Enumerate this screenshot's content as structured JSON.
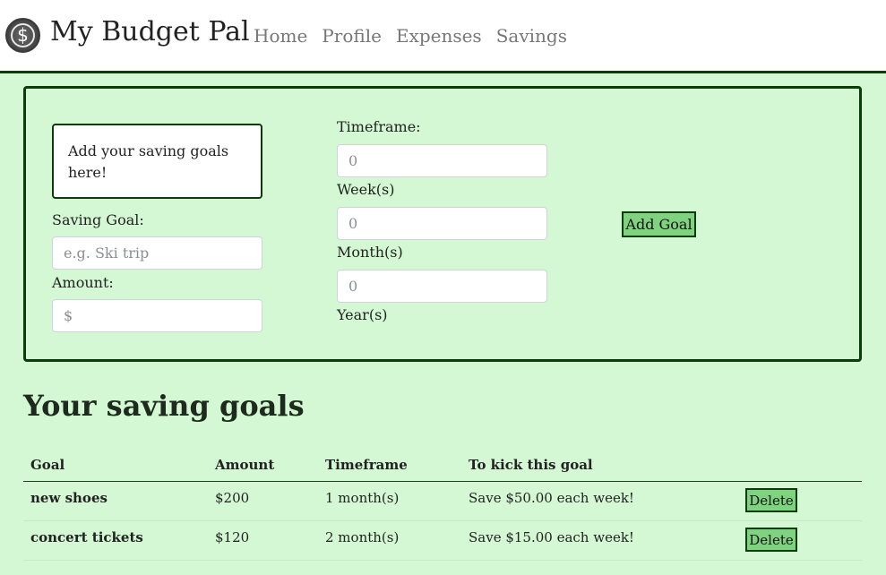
{
  "navbar": {
    "logo_symbol": "$",
    "brand": "My Budget Pal",
    "links": [
      "Home",
      "Profile",
      "Expenses",
      "Savings"
    ]
  },
  "form": {
    "info_text": "Add your saving goals here!",
    "saving_goal_label": "Saving Goal:",
    "saving_goal_placeholder": "e.g. Ski trip",
    "amount_label": "Amount:",
    "amount_placeholder": "$",
    "timeframe_label": "Timeframe:",
    "weeks_placeholder": "0",
    "weeks_label": "Week(s)",
    "months_placeholder": "0",
    "months_label": "Month(s)",
    "years_placeholder": "0",
    "years_label": "Year(s)",
    "add_button": "Add Goal"
  },
  "goals": {
    "title": "Your saving goals",
    "columns": [
      "Goal",
      "Amount",
      "Timeframe",
      "To kick this goal"
    ],
    "rows": [
      {
        "goal": "new shoes",
        "amount": "$200",
        "timeframe": "1 month(s)",
        "plan": "Save $50.00 each week!",
        "delete": "Delete"
      },
      {
        "goal": "concert tickets",
        "amount": "$120",
        "timeframe": "2 month(s)",
        "plan": "Save $15.00 each week!",
        "delete": "Delete"
      }
    ]
  },
  "colors": {
    "background": "#d4f8d4",
    "border": "#0b3d0b",
    "button": "#7fd27f"
  }
}
